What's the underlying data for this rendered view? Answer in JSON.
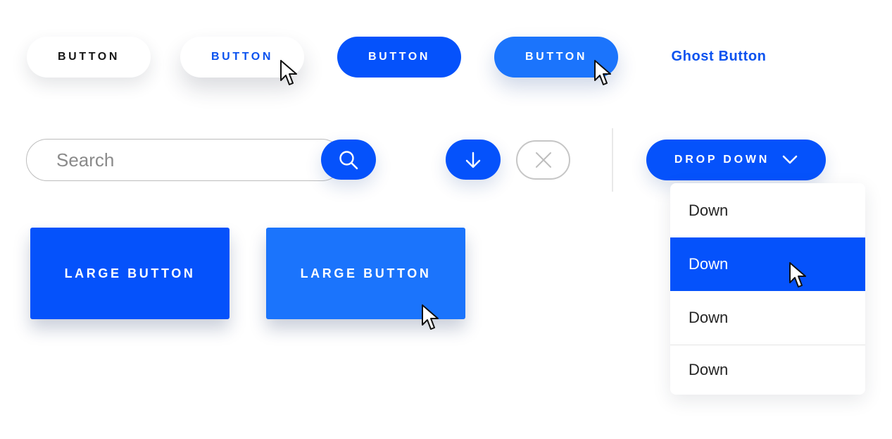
{
  "row1": {
    "buttons": [
      {
        "label": "BUTTON",
        "variant": "white"
      },
      {
        "label": "BUTTON",
        "variant": "white-hover"
      },
      {
        "label": "BUTTON",
        "variant": "blue"
      },
      {
        "label": "BUTTON",
        "variant": "blue-hover"
      }
    ],
    "ghost_label": "Ghost Button"
  },
  "search": {
    "placeholder": "Search",
    "button_icon": "search-icon"
  },
  "icons": {
    "download": "arrow-down-icon",
    "close": "close-icon",
    "dropdown_chevron": "chevron-down-icon"
  },
  "dropdown": {
    "label": "DROP DOWN",
    "items": [
      {
        "label": "Down",
        "active": false
      },
      {
        "label": "Down",
        "active": true
      },
      {
        "label": "Down",
        "active": false
      },
      {
        "label": "Down",
        "active": false
      }
    ]
  },
  "large_buttons": [
    {
      "label": "LARGE BUTTON",
      "variant": "default"
    },
    {
      "label": "LARGE BUTTON",
      "variant": "hover"
    }
  ],
  "colors": {
    "primary": "#0552fb",
    "primary_hover": "#1b74fc",
    "ghost_text": "#0a52ef",
    "dark_text": "#161616",
    "border_gray": "#bdbdbd"
  }
}
